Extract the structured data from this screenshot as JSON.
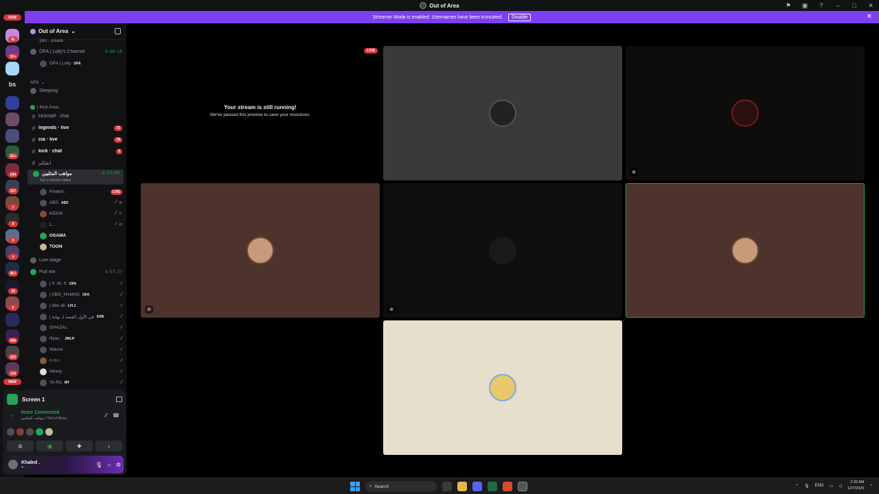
{
  "window": {
    "title": "Out of Area"
  },
  "banner": {
    "text": "Streamer Mode is enabled. Usernames have been truncated.",
    "disable_label": "Disable"
  },
  "server_rail": {
    "top_new": "NEW",
    "bottom_new": "NEW",
    "text_server": "bs",
    "badges": [
      "81",
      "1K+",
      "1K+",
      "244",
      "317",
      "7",
      "9",
      "9",
      "4",
      "3K+",
      "39",
      "6",
      "906",
      "252",
      "134"
    ]
  },
  "guild": {
    "name": "Out of Area"
  },
  "channels": {
    "create_text": "join · create",
    "ofa_channel": {
      "name": "OFA | Lolly's Channel",
      "timer": "9:08:18",
      "member": "OFA | Lolly",
      "member_tag": "OFA"
    },
    "afk_category": "AFK",
    "sleeping": "Sleeping",
    "kick_category": "| Kick Area",
    "kickstaff": "kickstaff · chat",
    "legends": {
      "name": "legends · live",
      "badge": "72"
    },
    "cia": {
      "name": "cia · live",
      "badge": "76"
    },
    "kick_chat": {
      "name": "kick · chat",
      "badge": "3"
    },
    "arabic_text": "انقلكم",
    "active_voice": {
      "name": "مواهب المثليين",
      "timer": "4:57:00",
      "status": "Set a channel status"
    },
    "active_users": [
      {
        "name": "Khaled .",
        "tag": "",
        "live": "LIVE"
      },
      {
        "name": "ABS",
        "tag": "ABS"
      },
      {
        "name": "KEKW",
        "tag": ""
      },
      {
        "name": "L...",
        "tag": ""
      },
      {
        "name": "OSAMA",
        "tag": ""
      },
      {
        "name": "TOON",
        "tag": ""
      }
    ],
    "live_stage": "Live stage",
    "pull_me": {
      "name": "Pull me",
      "timer": "4:57:27"
    },
    "pull_users": [
      {
        "name": "| X .M. X",
        "tag": "OFA"
      },
      {
        "name": "| ABO_HAMAD",
        "tag": "OFA"
      },
      {
        "name": "| abu ali",
        "tag": "LVL1"
      },
      {
        "name": "| في الأول القصة لـ نهاية",
        "tag": "SXB"
      },
      {
        "name": "GHAZAL",
        "tag": ""
      },
      {
        "name": "lilyas ;",
        "tag": "JWLH"
      },
      {
        "name": "Mauve",
        "tag": ""
      },
      {
        "name": "n.m.r",
        "tag": ""
      },
      {
        "name": "Ninety .",
        "tag": ""
      },
      {
        "name": "Yo-Rq",
        "tag": "MT"
      }
    ]
  },
  "panel": {
    "screen_label": "Screen 1",
    "voice_connected": "Voice Connected",
    "voice_location": "مواهب المثليين / Out of Area",
    "user_name": "Khaled .",
    "user_status": "● · ·"
  },
  "stage": {
    "live_label": "LIVE",
    "stream_title": "Your stream is still running!",
    "stream_sub": "We've paused this preview to save your resources."
  },
  "taskbar": {
    "search_label": "Search",
    "lang": "ENG",
    "time": "2:30 AM",
    "date": "12/7/2025"
  },
  "colors": {
    "accent": "#7d3ff0",
    "speaking": "#23a55a",
    "badge": "#da373c",
    "tile_grey": "#3a3a3a",
    "tile_dark": "#0f0d0c",
    "tile_brown": "#4e332c",
    "tile_cream": "#e6dfcc"
  }
}
